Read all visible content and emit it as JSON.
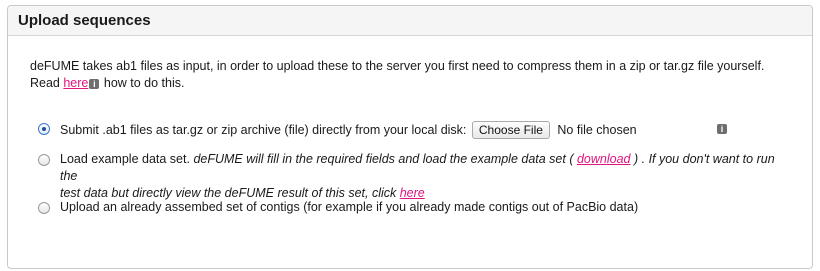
{
  "panel": {
    "title": "Upload sequences"
  },
  "intro": {
    "text_before": "deFUME takes ab1 files as input, in order to upload these to the server you first need to compress them in a zip or tar.gz file yourself. Read ",
    "link_label": "here",
    "text_after": " how to do this."
  },
  "options": {
    "upload_archive": {
      "label": "Submit .ab1 files as tar.gz or zip archive (file) directly from your local disk:",
      "checked": true,
      "file_button": "Choose File",
      "file_status": "No file chosen"
    },
    "example_data": {
      "label": "Load example data set.",
      "description_1": "deFUME will fill in the required fields and load the example data set (",
      "download_link": "download",
      "description_2": ") . If you don't want to run the",
      "description_3": "test data but directly view the deFUME result of this set, click ",
      "here_link": "here",
      "checked": false
    },
    "assembled_contigs": {
      "label": "Upload an already assembed set of contigs (for example if you already made contigs out of PacBio data)",
      "checked": false
    }
  },
  "icons": {
    "info": "info-icon"
  },
  "colors": {
    "link": "#e0157f",
    "radio_selected": "#1d4f9c"
  }
}
